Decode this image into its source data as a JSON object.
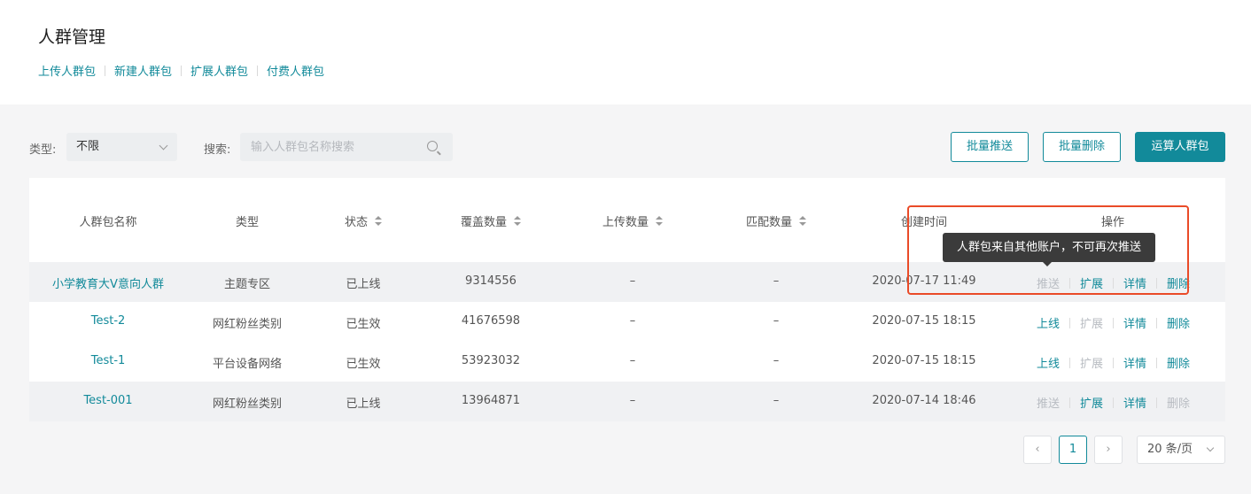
{
  "header": {
    "title": "人群管理",
    "nav": [
      "上传人群包",
      "新建人群包",
      "扩展人群包",
      "付费人群包"
    ]
  },
  "filters": {
    "type_label": "类型:",
    "type_value": "不限",
    "search_label": "搜索:",
    "search_placeholder": "输入人群包名称搜索"
  },
  "actions": {
    "batch_push": "批量推送",
    "batch_delete": "批量删除",
    "compute": "运算人群包"
  },
  "table": {
    "columns": [
      "人群包名称",
      "类型",
      "状态",
      "覆盖数量",
      "上传数量",
      "匹配数量",
      "创建时间",
      "操作"
    ],
    "rows": [
      {
        "name": "小学教育大V意向人群",
        "type": "主题专区",
        "status": "已上线",
        "coverage": "9314556",
        "upload": "–",
        "match": "–",
        "created": "2020-07-17 11:49",
        "ops": [
          "推送",
          "扩展",
          "详情",
          "删除"
        ],
        "ops_enabled": [
          false,
          true,
          true,
          true
        ]
      },
      {
        "name": "Test-2",
        "type": "网红粉丝类别",
        "status": "已生效",
        "coverage": "41676598",
        "upload": "–",
        "match": "–",
        "created": "2020-07-15 18:15",
        "ops": [
          "上线",
          "扩展",
          "详情",
          "删除"
        ],
        "ops_enabled": [
          true,
          false,
          true,
          true
        ]
      },
      {
        "name": "Test-1",
        "type": "平台设备网络",
        "status": "已生效",
        "coverage": "53923032",
        "upload": "–",
        "match": "–",
        "created": "2020-07-15 18:15",
        "ops": [
          "上线",
          "扩展",
          "详情",
          "删除"
        ],
        "ops_enabled": [
          true,
          false,
          true,
          true
        ]
      },
      {
        "name": "Test-001",
        "type": "网红粉丝类别",
        "status": "已上线",
        "coverage": "13964871",
        "upload": "–",
        "match": "–",
        "created": "2020-07-14 18:46",
        "ops": [
          "推送",
          "扩展",
          "详情",
          "删除"
        ],
        "ops_enabled": [
          false,
          true,
          true,
          false
        ]
      }
    ]
  },
  "tooltip": "人群包来自其他账户，不可再次推送",
  "pagination": {
    "prev": "‹",
    "current": "1",
    "next": "›",
    "page_size": "20 条/页"
  },
  "colors": {
    "accent": "#128a9a",
    "highlight": "#ea4b28",
    "disabled": "#b8bcc2"
  }
}
